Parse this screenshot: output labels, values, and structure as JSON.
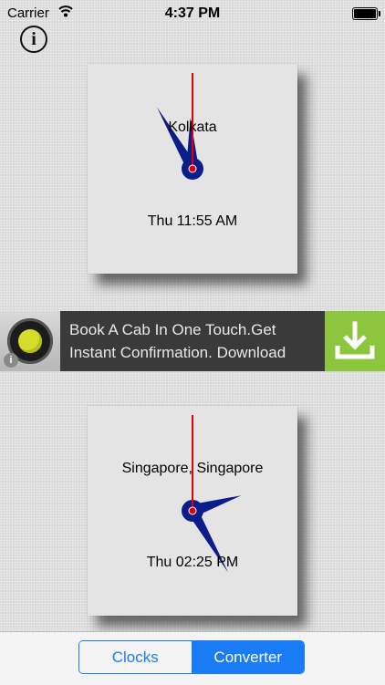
{
  "status_bar": {
    "carrier": "Carrier",
    "time": "4:37 PM"
  },
  "info_button": {
    "label": "i"
  },
  "clocks": [
    {
      "city": "Kolkata",
      "time_text": "Thu 11:55 AM",
      "hour": 11,
      "minute": 55
    },
    {
      "city": "Singapore, Singapore",
      "time_text": "Thu 02:25 PM",
      "hour": 2,
      "minute": 25
    }
  ],
  "ad": {
    "text": "Book A Cab In One Touch.Get Instant Confirmation. Download",
    "info_icon_label": "i",
    "icons": {
      "logo": "ola-logo-icon",
      "download": "download-icon",
      "info": "info-icon"
    },
    "download_bg": "#8cc63f"
  },
  "tabs": {
    "clocks_label": "Clocks",
    "converter_label": "Converter",
    "selected": "converter"
  },
  "colors": {
    "accent": "#1a7cf5",
    "hand_color": "#0b1d8a",
    "second_hand_color": "#e00000"
  }
}
